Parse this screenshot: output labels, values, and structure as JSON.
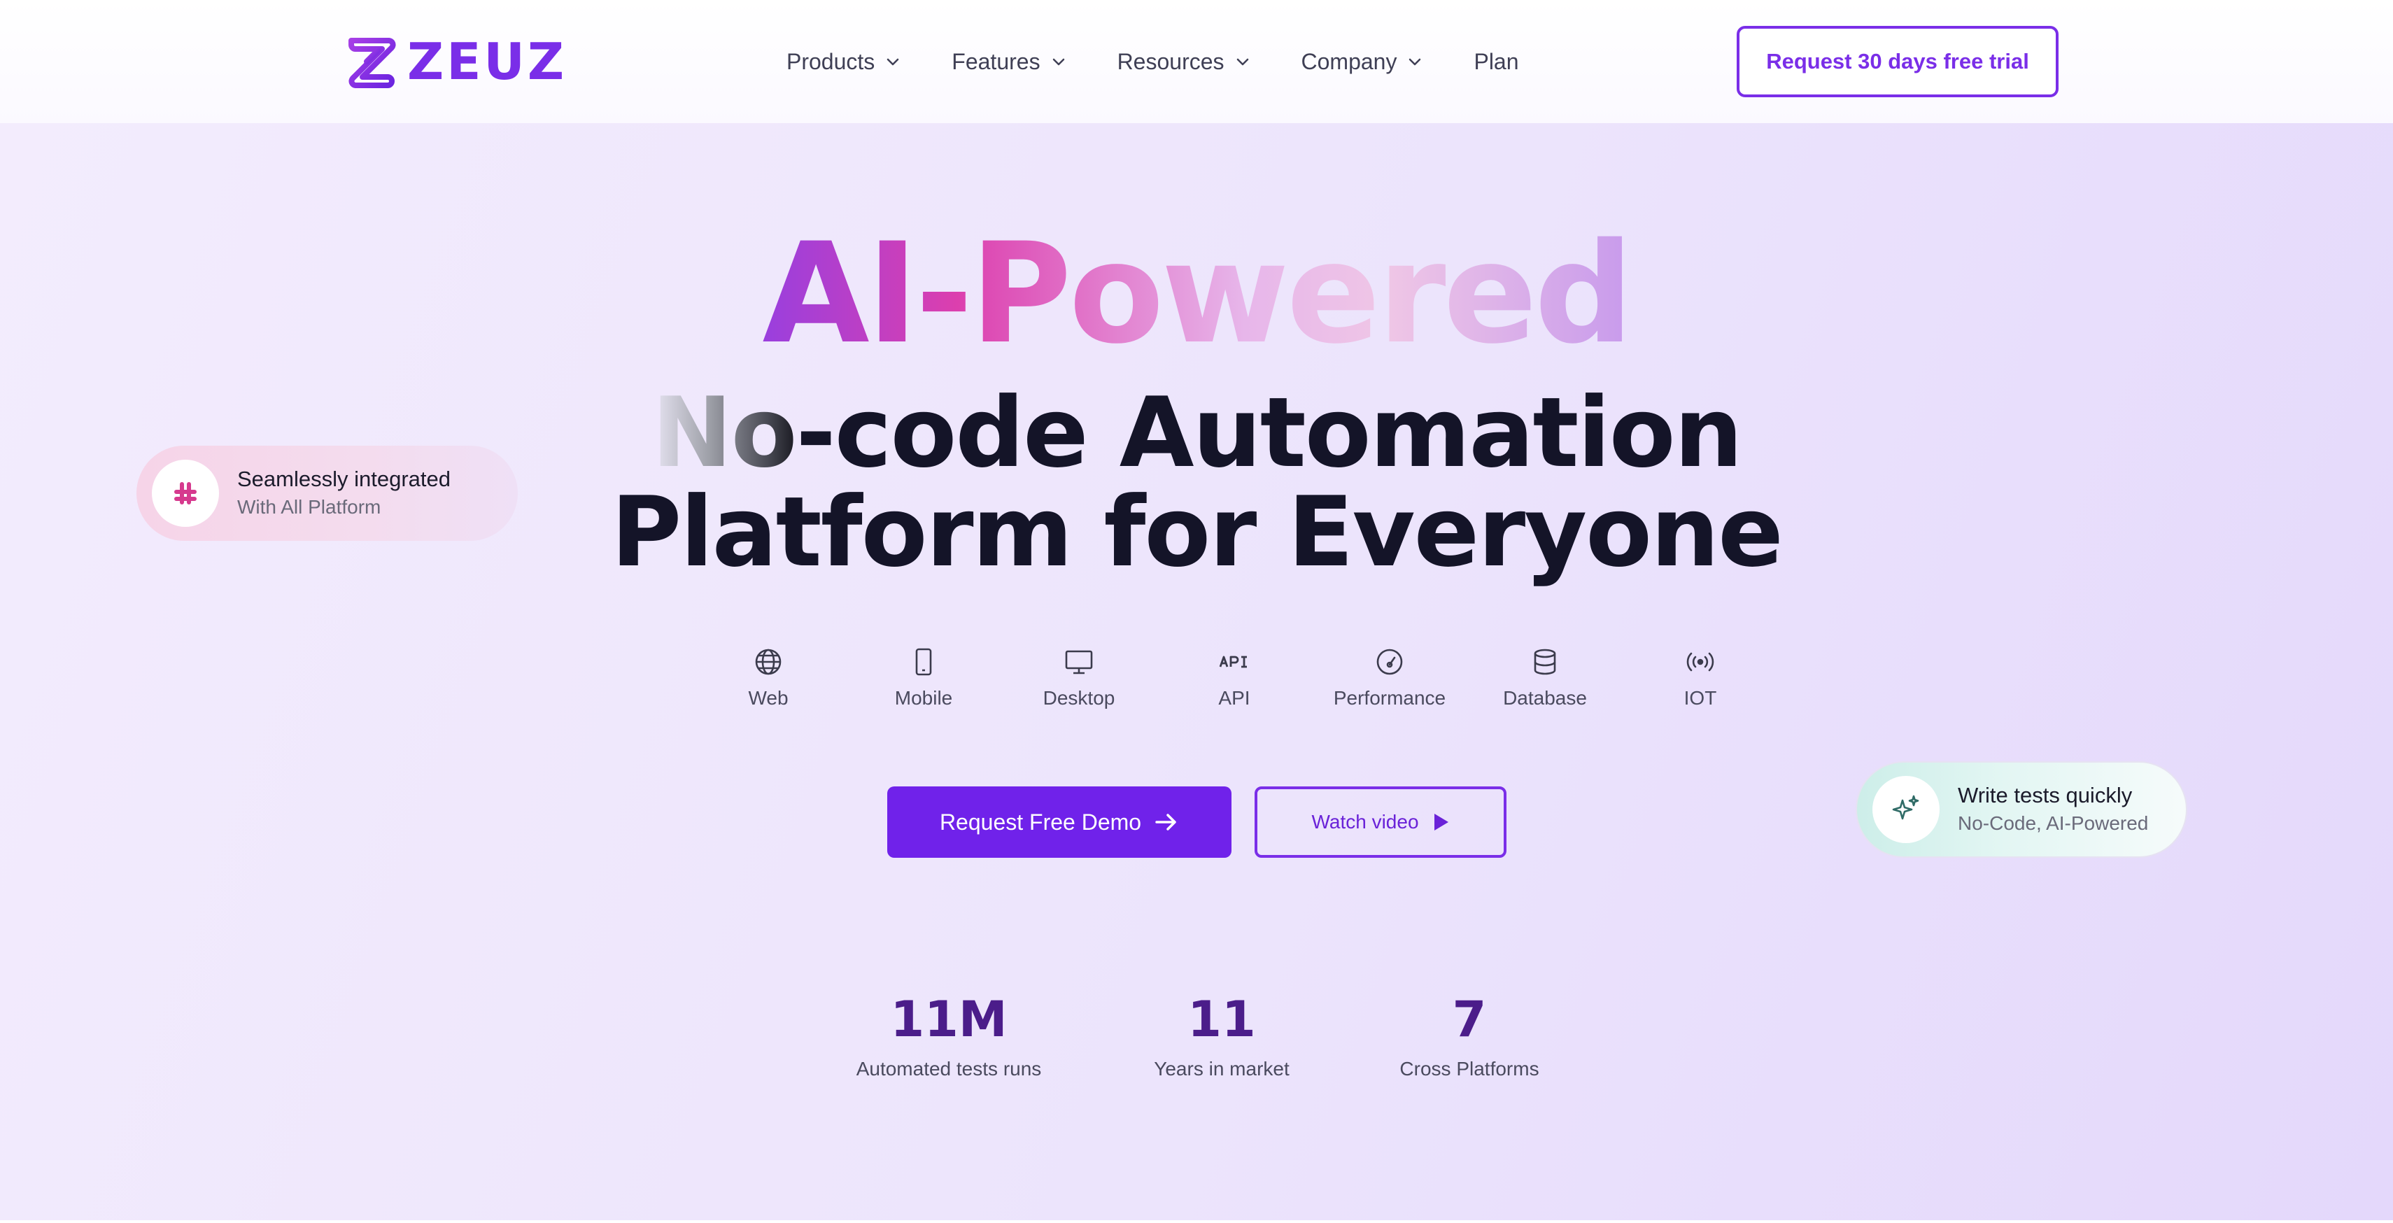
{
  "brand": {
    "name": "ZEUZ",
    "color": "#7a2ee8"
  },
  "nav": {
    "items": [
      {
        "label": "Products",
        "icon": "chevron-down-icon"
      },
      {
        "label": "Features",
        "icon": "chevron-down-icon"
      },
      {
        "label": "Resources",
        "icon": "chevron-down-icon"
      },
      {
        "label": "Company",
        "icon": "chevron-down-icon"
      },
      {
        "label": "Plan"
      }
    ],
    "cta": "Request 30 days free trial"
  },
  "hero": {
    "headline": "AI-Powered",
    "subheadline_line1_faded": "No",
    "subheadline_line1_rest": "-code Automation",
    "subheadline_line2": "Platform for Everyone",
    "platforms": [
      {
        "label": "Web",
        "icon": "globe-icon"
      },
      {
        "label": "Mobile",
        "icon": "mobile-phone-icon"
      },
      {
        "label": "Desktop",
        "icon": "monitor-icon"
      },
      {
        "label": "API",
        "icon": "api-icon"
      },
      {
        "label": "Performance",
        "icon": "gauge-icon"
      },
      {
        "label": "Database",
        "icon": "database-icon"
      },
      {
        "label": "IOT",
        "icon": "broadcast-icon"
      }
    ],
    "primary_cta": "Request Free Demo",
    "secondary_cta": "Watch video"
  },
  "cards": {
    "integration": {
      "title": "Seamlessly integrated",
      "subtitle": "With All Platform",
      "icon": "slack-icon"
    },
    "quick_tests": {
      "title": "Write tests quickly",
      "subtitle": "No-Code, AI-Powered",
      "icon": "sparkles-icon"
    }
  },
  "stats": [
    {
      "value": "11M",
      "label": "Automated tests runs"
    },
    {
      "value": "11",
      "label": "Years in market"
    },
    {
      "value": "7",
      "label": "Cross Platforms"
    }
  ],
  "colors": {
    "accent": "#7022ea",
    "stat_number": "#4b1d8a",
    "hero_bg": "#ece4fc"
  }
}
